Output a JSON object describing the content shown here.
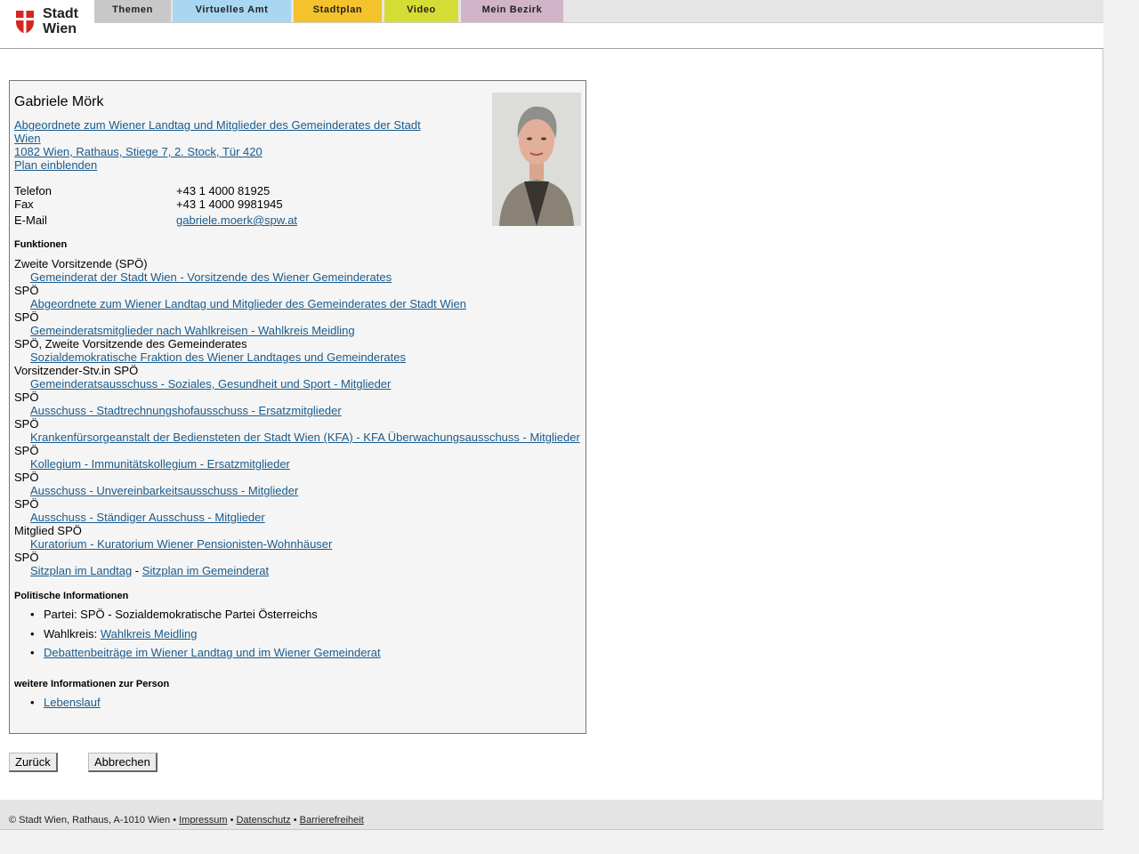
{
  "header": {
    "logo_text_1": "Stadt",
    "logo_text_2": "Wien",
    "tabs": [
      {
        "label": "Themen",
        "color": "#c8c8c8"
      },
      {
        "label": "Virtuelles Amt",
        "color": "#a9d6f0"
      },
      {
        "label": "Stadtplan",
        "color": "#f4c22b"
      },
      {
        "label": "Video",
        "color": "#d5dc35"
      },
      {
        "label": "Mein Bezirk",
        "color": "#d2b4c8"
      }
    ]
  },
  "person": {
    "name": "Gabriele Mörk",
    "role_link_1": "Abgeordnete zum Wiener Landtag und Mitglieder des Gemeinderates der Stadt",
    "role_link_2": "Wien",
    "address": "1082 Wien, Rathaus, Stiege 7, 2. Stock, Tür 420",
    "plan": "Plan einblenden",
    "contact": {
      "phone_label": "Telefon",
      "phone": "+43 1 4000 81925",
      "fax_label": "Fax",
      "fax": "+43 1 4000 9981945",
      "email_label": "E-Mail",
      "email": "gabriele.moerk@spw.at"
    }
  },
  "functions": {
    "heading": "Funktionen",
    "items": [
      {
        "role": "Zweite Vorsitzende (SPÖ)",
        "link": "Gemeinderat der Stadt Wien - Vorsitzende des Wiener Gemeinderates"
      },
      {
        "role": "SPÖ",
        "link": "Abgeordnete zum Wiener Landtag und Mitglieder des Gemeinderates der Stadt Wien"
      },
      {
        "role": "SPÖ",
        "link": "Gemeinderatsmitglieder nach Wahlkreisen - Wahlkreis Meidling"
      },
      {
        "role": "SPÖ, Zweite Vorsitzende des Gemeinderates",
        "link": "Sozialdemokratische Fraktion des Wiener Landtages und Gemeinderates"
      },
      {
        "role": "Vorsitzender-Stv.in SPÖ",
        "link": "Gemeinderatsausschuss - Soziales, Gesundheit und Sport - Mitglieder"
      },
      {
        "role": "SPÖ",
        "link": "Ausschuss - Stadtrechnungshofausschuss - Ersatzmitglieder"
      },
      {
        "role": "SPÖ",
        "link": "Krankenfürsorgeanstalt der Bediensteten der Stadt Wien (KFA) - KFA Überwachungsausschuss - Mitglieder"
      },
      {
        "role": "SPÖ",
        "link": "Kollegium - Immunitätskollegium - Ersatzmitglieder"
      },
      {
        "role": "SPÖ",
        "link": "Ausschuss - Unvereinbarkeitsausschuss - Mitglieder"
      },
      {
        "role": "SPÖ",
        "link": "Ausschuss - Ständiger Ausschuss - Mitglieder"
      },
      {
        "role": "Mitglied SPÖ",
        "link": "Kuratorium - Kuratorium Wiener Pensionisten-Wohnhäuser"
      },
      {
        "role": "SPÖ",
        "link": ""
      }
    ],
    "seat_landtag": "Sitzplan im Landtag",
    "seat_sep": " - ",
    "seat_gemeinderat": "Sitzplan im Gemeinderat"
  },
  "political": {
    "heading": "Politische Informationen",
    "party": "Partei: SPÖ - Sozialdemokratische Partei Österreichs",
    "district_label": "Wahlkreis: ",
    "district_link": "Wahlkreis Meidling",
    "debates": "Debattenbeiträge im Wiener Landtag und im Wiener Gemeinderat"
  },
  "more": {
    "heading": "weitere Informationen zur Person",
    "cv": "Lebenslauf"
  },
  "buttons": {
    "back": "Zurück",
    "cancel": "Abbrechen"
  },
  "footer": {
    "copyright": "© Stadt Wien, Rathaus, A-1010 Wien • ",
    "impressum": "Impressum",
    "sep": " • ",
    "datenschutz": "Datenschutz",
    "barriere": "Barrierefreiheit"
  }
}
